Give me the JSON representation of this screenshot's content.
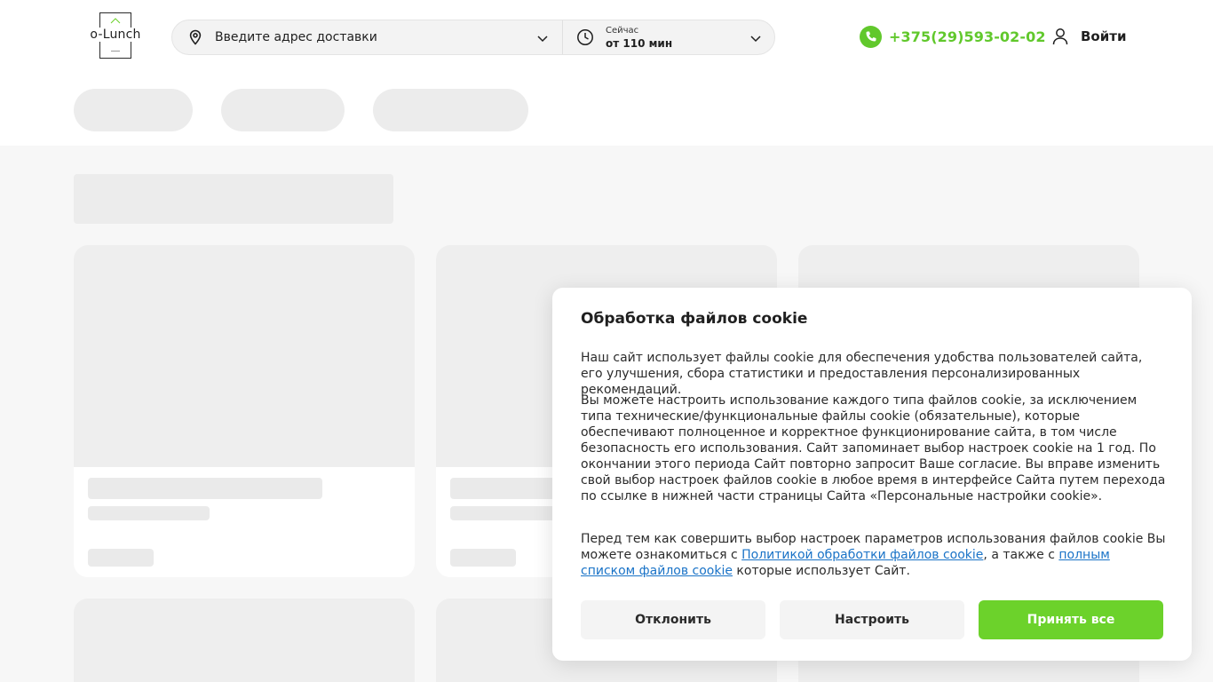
{
  "header": {
    "logo_text": "o-Lunch",
    "address_placeholder": "Введите адрес доставки",
    "time_label": "Сейчас",
    "time_value": "от 110 мин",
    "phone": "+375(29)593-02-02",
    "login_label": "Войти"
  },
  "colors": {
    "accent_green": "#6cd22b",
    "link_blue": "#1a73c7",
    "skeleton_grey": "#ececec"
  },
  "cookie": {
    "title": "Обработка файлов cookie",
    "p1": "Наш сайт использует файлы cookie для обеспечения удобства пользователей сайта, его улучшения, сбора статистики и предоставления персонализированных рекомендаций.",
    "p2": "Вы можете настроить использование каждого типа файлов cookie, за исключением типа технические/функциональные файлы cookie (обязательные), которые обеспечивают полноценное и корректное функционирование сайта, в том числе безопасность его использования. Сайт запоминает выбор настроек cookie на 1 год. По окончании этого периода Сайт повторно запросит Ваше согласие. Вы вправе изменить свой выбор настроек файлов cookie в любое время в интерфейсе Сайта путем перехода по ссылке в нижней части страницы Сайта «Персональные настройки cookie».",
    "p3_before": "Перед тем как совершить выбор настроек параметров использования файлов cookie Вы можете ознакомиться с ",
    "p3_link1": "Политикой обработки файлов cookie",
    "p3_middle": ", а также с ",
    "p3_link2": "полным списком файлов cookie",
    "p3_after": " которые использует Сайт.",
    "decline_label": "Отклонить",
    "configure_label": "Настроить",
    "accept_label": "Принять все"
  }
}
